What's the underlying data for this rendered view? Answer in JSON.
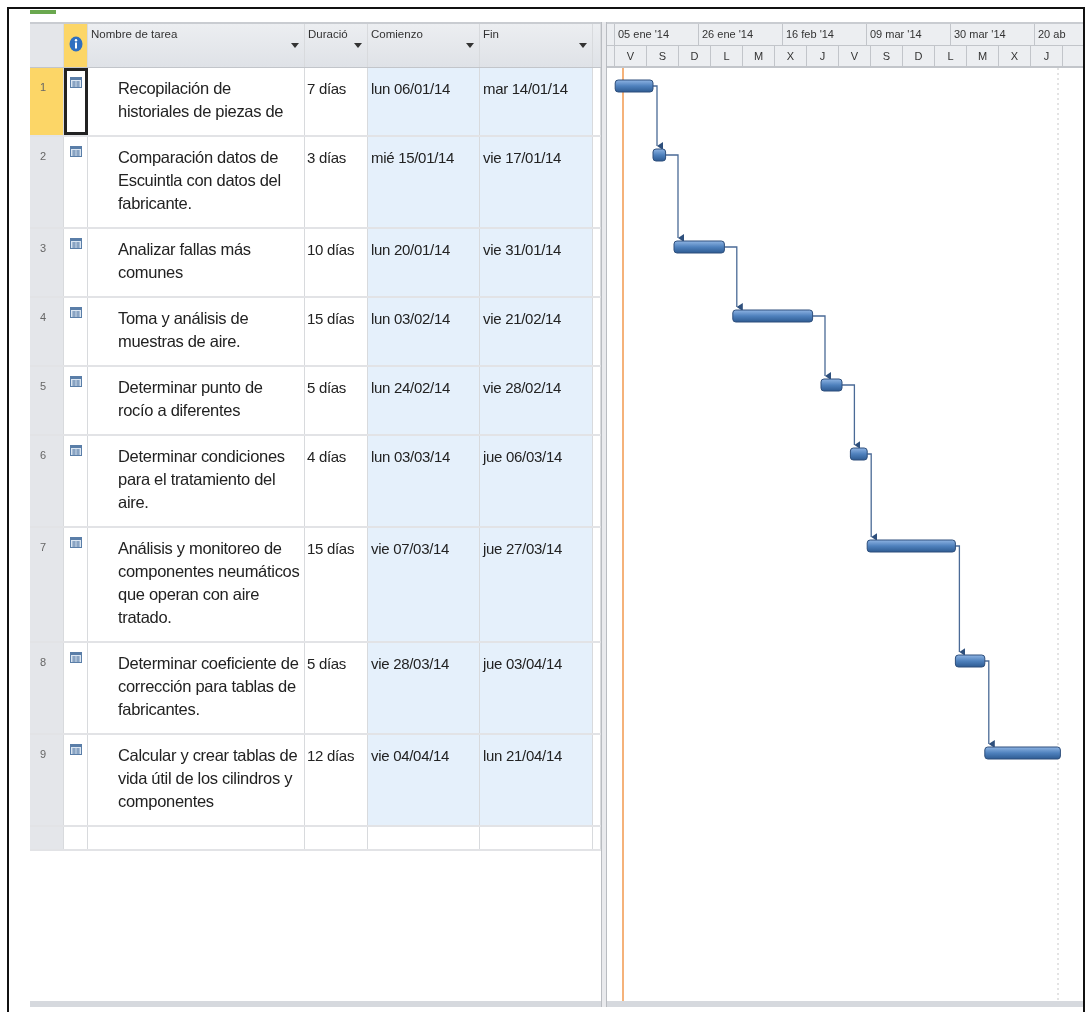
{
  "table": {
    "columns": [
      {
        "label": "Nombre de tarea"
      },
      {
        "label": "Duració"
      },
      {
        "label": "Comienzo"
      },
      {
        "label": "Fin"
      }
    ],
    "rows": [
      {
        "id": "1",
        "name": "Recopilación de historiales de piezas de",
        "duration": "7 días",
        "start": "lun 06/01/14",
        "end": "mar 14/01/14",
        "selected": true
      },
      {
        "id": "2",
        "name": "Comparación datos de Escuintla con datos del fabricante.",
        "duration": "3 días",
        "start": "mié 15/01/14",
        "end": "vie 17/01/14",
        "selected": false
      },
      {
        "id": "3",
        "name": "Analizar fallas más comunes",
        "duration": "10 días",
        "start": "lun 20/01/14",
        "end": "vie 31/01/14",
        "selected": false
      },
      {
        "id": "4",
        "name": "Toma y análisis de muestras de aire.",
        "duration": "15 días",
        "start": "lun 03/02/14",
        "end": "vie 21/02/14",
        "selected": false
      },
      {
        "id": "5",
        "name": "Determinar punto de rocío a diferentes",
        "duration": "5 días",
        "start": "lun 24/02/14",
        "end": "vie 28/02/14",
        "selected": false
      },
      {
        "id": "6",
        "name": "Determinar condiciones para el tratamiento del aire.",
        "duration": "4 días",
        "start": "lun 03/03/14",
        "end": "jue 06/03/14",
        "selected": false
      },
      {
        "id": "7",
        "name": "Análisis y monitoreo de componentes neumáticos que operan con aire tratado.",
        "duration": "15 días",
        "start": "vie 07/03/14",
        "end": "jue 27/03/14",
        "selected": false
      },
      {
        "id": "8",
        "name": "Determinar coeficiente de corrección para tablas de fabricantes.",
        "duration": "5 días",
        "start": "vie 28/03/14",
        "end": "jue 03/04/14",
        "selected": false
      },
      {
        "id": "9",
        "name": "Calcular y crear tablas de vida útil de los cilindros y componentes",
        "duration": "12 días",
        "start": "vie 04/04/14",
        "end": "lun 21/04/14",
        "selected": false
      }
    ]
  },
  "timescale": {
    "top": [
      "05 ene '14",
      "26 ene '14",
      "16 feb '14",
      "09 mar '14",
      "30 mar '14",
      "20 ab"
    ],
    "bottom": [
      "V",
      "S",
      "D",
      "L",
      "M",
      "X",
      "J",
      "V",
      "S",
      "D",
      "L",
      "M",
      "X",
      "J"
    ]
  }
}
